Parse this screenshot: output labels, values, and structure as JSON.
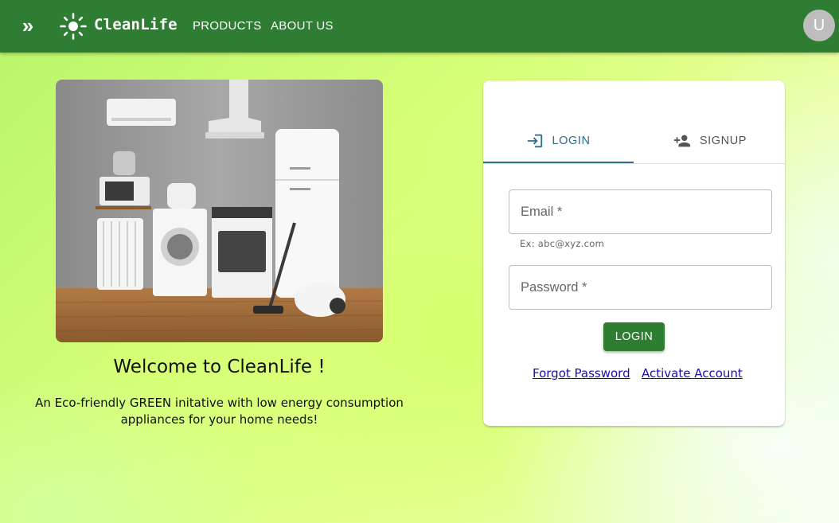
{
  "app": {
    "brand": "CleanLife",
    "nav": [
      {
        "label": "PRODUCTS"
      },
      {
        "label": "ABOUT US"
      }
    ],
    "menu_glyph": "»",
    "avatar_initial": "U",
    "icons": [
      "menu-expand-icon",
      "sun-logo-icon"
    ],
    "colors": {
      "appbar": "#2e7d32",
      "accent": "#2a6f8c",
      "button": "#2e7d32"
    }
  },
  "hero": {
    "image_subject": "home-appliances-photo",
    "welcome": "Welcome to CleanLife !",
    "tagline": "An Eco-friendly GREEN initative with low energy consumption appliances for your home needs!"
  },
  "auth": {
    "tabs": [
      {
        "label": "LOGIN",
        "icon": "login-icon",
        "selected": true
      },
      {
        "label": "SIGNUP",
        "icon": "add-person-icon",
        "selected": false
      }
    ],
    "email": {
      "placeholder": "Email *",
      "value": "",
      "helper": "Ex: abc@xyz.com"
    },
    "password": {
      "placeholder": "Password *",
      "value": ""
    },
    "login_button": "LOGIN",
    "links": {
      "forgot": "Forgot Password",
      "activate": "Activate Account"
    }
  }
}
